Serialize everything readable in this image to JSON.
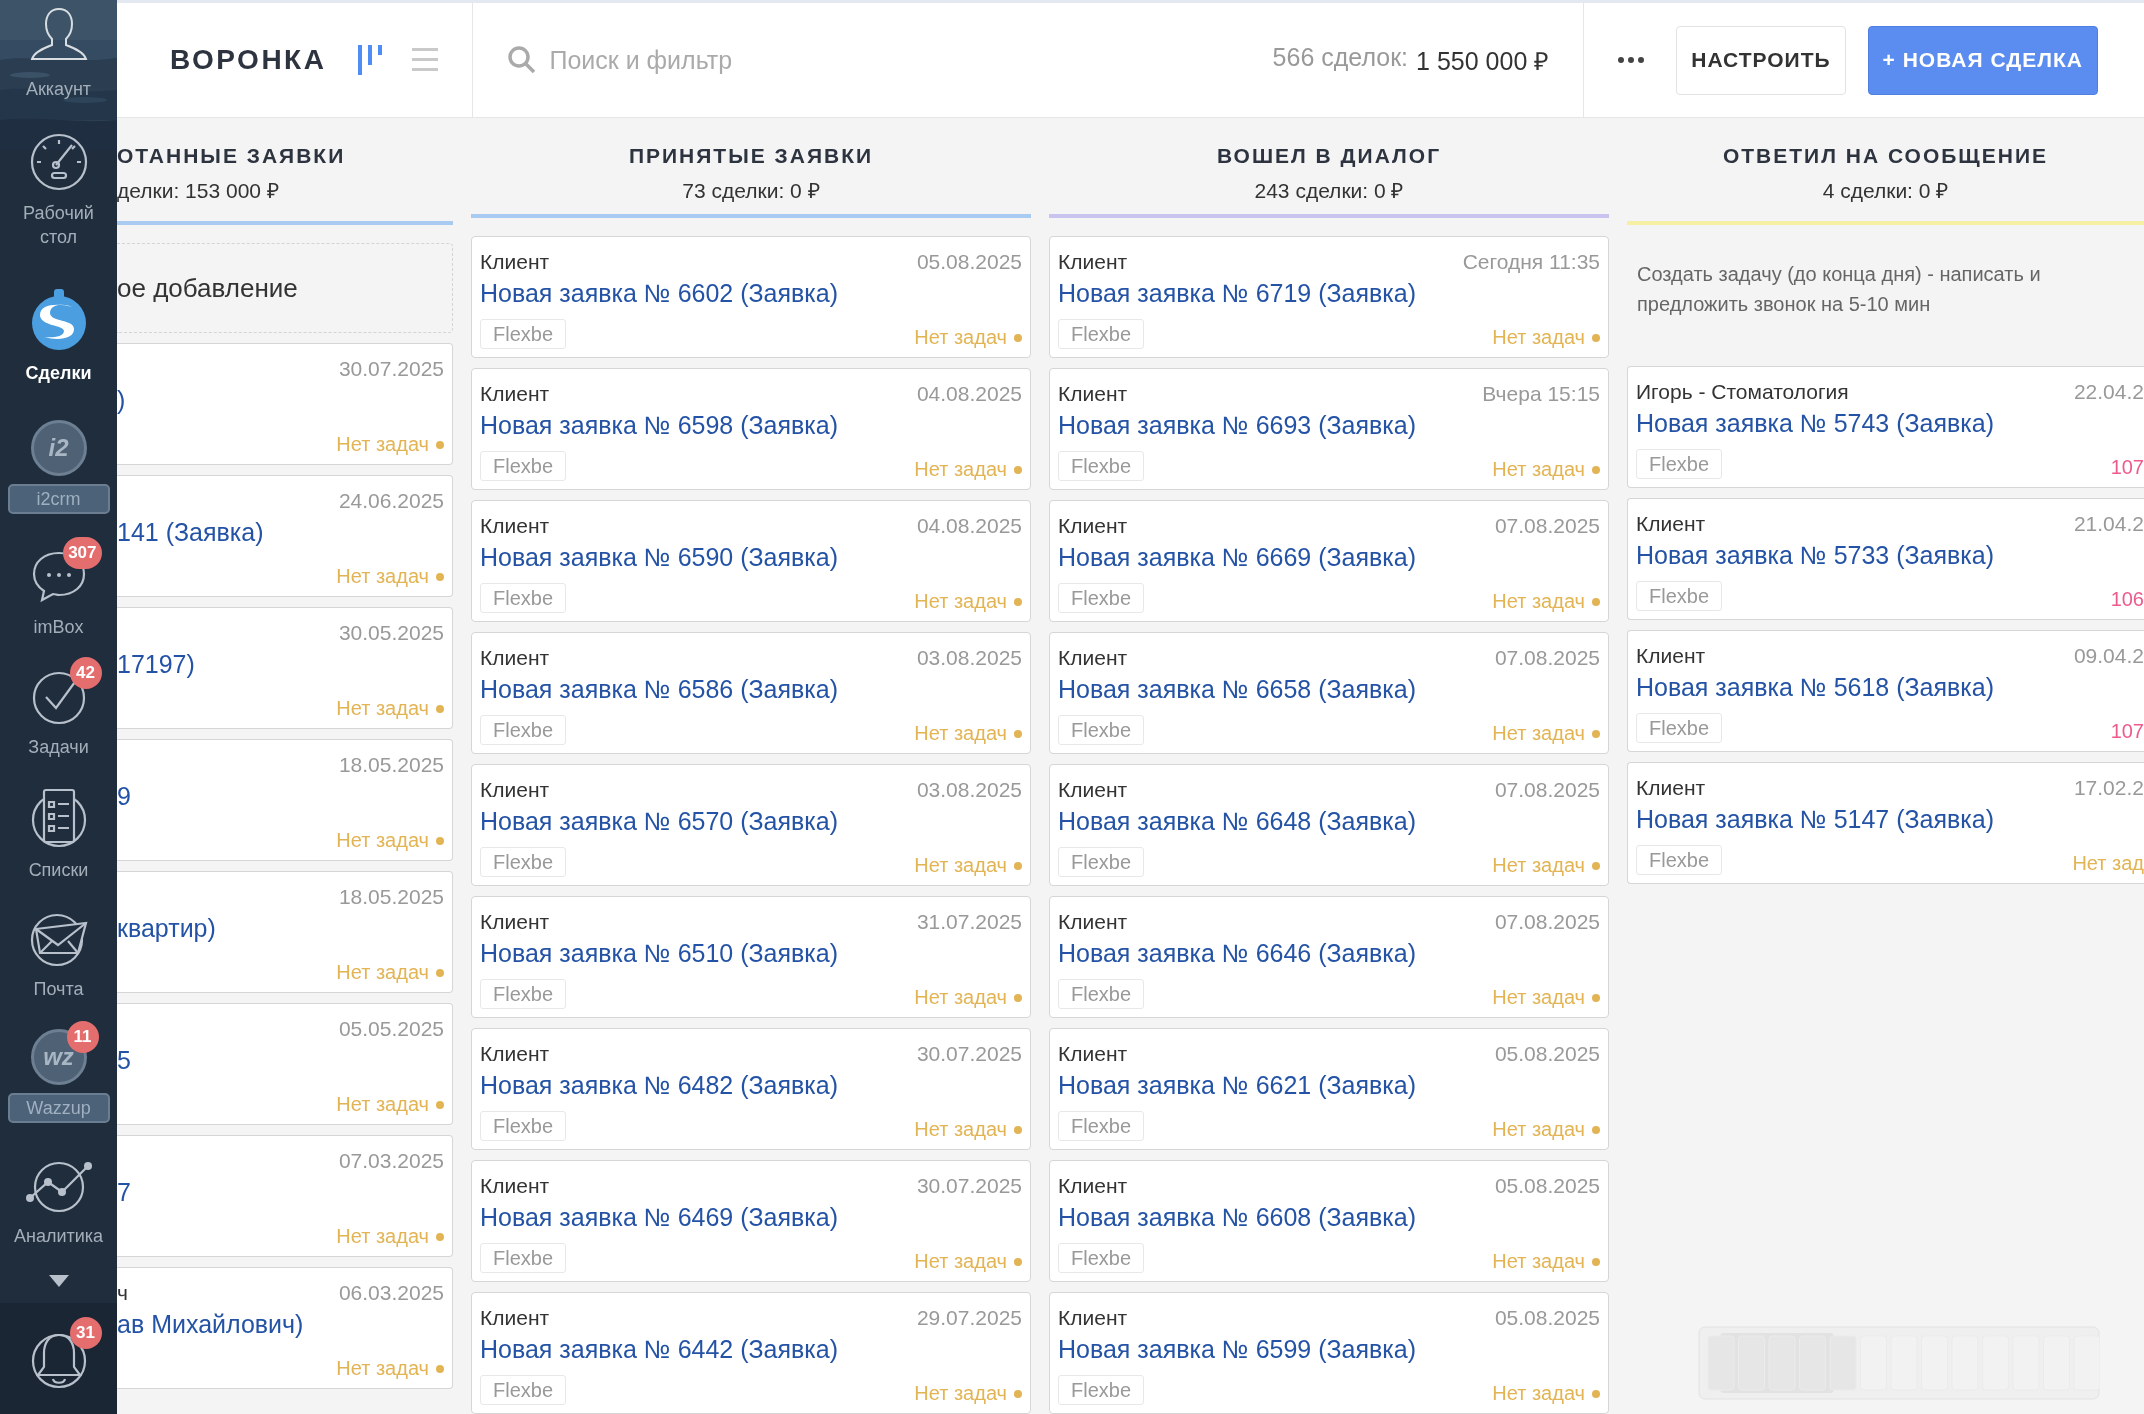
{
  "sidebar": {
    "items": [
      {
        "kind": "account",
        "label": "Аккаунт",
        "selected": false
      },
      {
        "kind": "dashboard",
        "label": "Рабочий стол",
        "selected": false
      },
      {
        "kind": "deals",
        "label": "Сделки",
        "selected": true
      },
      {
        "kind": "app",
        "icon_text": "i2",
        "label": "i2crm",
        "selected": false
      },
      {
        "kind": "chat",
        "label": "imBox",
        "badge": "307",
        "selected": false
      },
      {
        "kind": "tasks",
        "label": "Задачи",
        "badge": "42",
        "selected": false
      },
      {
        "kind": "lists",
        "label": "Списки",
        "selected": false
      },
      {
        "kind": "mail",
        "label": "Почта",
        "selected": false
      },
      {
        "kind": "app",
        "icon_text": "wz",
        "label": "Wazzup",
        "badge": "11",
        "selected": false
      },
      {
        "kind": "analytics",
        "label": "Аналитика",
        "selected": false
      }
    ],
    "notifications": {
      "badge": "31"
    }
  },
  "topbar": {
    "title": "ВОРОНКА",
    "views": [
      {
        "kind": "pipeline",
        "selected": true
      },
      {
        "kind": "list",
        "selected": false
      }
    ],
    "search": {
      "placeholder": "Поиск и фильтр"
    },
    "summary": {
      "count": "566 сделок:",
      "total": "1 550 000 ₽"
    },
    "buttons": [
      {
        "kind": "secondary",
        "label": "НАСТРОИТЬ"
      },
      {
        "kind": "primary",
        "label": "+ НОВАЯ СДЕЛКА"
      }
    ]
  },
  "columns": [
    {
      "title": "ОТАННЫЕ ЗАЯВКИ",
      "summary": "делки: 153 000 ₽",
      "color": "#a9cbf2",
      "quick_add": "ое добавление",
      "cards": [
        {
          "date": "30.07.2025",
          "title": ")",
          "status": {
            "kind": "no_tasks",
            "text": "Нет задач",
            "dot": true
          }
        },
        {
          "date": "24.06.2025",
          "title": "141 (Заявка)",
          "status": {
            "kind": "no_tasks",
            "text": "Нет задач",
            "dot": true
          }
        },
        {
          "date": "30.05.2025",
          "title": "17197)",
          "status": {
            "kind": "no_tasks",
            "text": "Нет задач",
            "dot": true
          }
        },
        {
          "date": "18.05.2025",
          "title": "9",
          "status": {
            "kind": "no_tasks",
            "text": "Нет задач",
            "dot": true
          }
        },
        {
          "date": "18.05.2025",
          "title": "квартир)",
          "status": {
            "kind": "no_tasks",
            "text": "Нет задач",
            "dot": true
          }
        },
        {
          "date": "05.05.2025",
          "title": "5",
          "status": {
            "kind": "no_tasks",
            "text": "Нет задач",
            "dot": true
          }
        },
        {
          "date": "07.03.2025",
          "title": "7",
          "status": {
            "kind": "no_tasks",
            "text": "Нет задач",
            "dot": true
          }
        },
        {
          "client": "ч",
          "date": "06.03.2025",
          "title": "ав Михайлович)",
          "status": {
            "kind": "no_tasks",
            "text": "Нет задач",
            "dot": true
          }
        }
      ]
    },
    {
      "title": "ПРИНЯТЫЕ ЗАЯВКИ",
      "summary": "73 сделки: 0 ₽",
      "color": "#a9cbf2",
      "cards": [
        {
          "client": "Клиент",
          "date": "05.08.2025",
          "title": "Новая заявка № 6602 (Заявка)",
          "tag": "Flexbe",
          "status": {
            "kind": "no_tasks",
            "text": "Нет задач",
            "dot": true
          }
        },
        {
          "client": "Клиент",
          "date": "04.08.2025",
          "title": "Новая заявка № 6598 (Заявка)",
          "tag": "Flexbe",
          "status": {
            "kind": "no_tasks",
            "text": "Нет задач",
            "dot": true
          }
        },
        {
          "client": "Клиент",
          "date": "04.08.2025",
          "title": "Новая заявка № 6590 (Заявка)",
          "tag": "Flexbe",
          "status": {
            "kind": "no_tasks",
            "text": "Нет задач",
            "dot": true
          }
        },
        {
          "client": "Клиент",
          "date": "03.08.2025",
          "title": "Новая заявка № 6586 (Заявка)",
          "tag": "Flexbe",
          "status": {
            "kind": "no_tasks",
            "text": "Нет задач",
            "dot": true
          }
        },
        {
          "client": "Клиент",
          "date": "03.08.2025",
          "title": "Новая заявка № 6570 (Заявка)",
          "tag": "Flexbe",
          "status": {
            "kind": "no_tasks",
            "text": "Нет задач",
            "dot": true
          }
        },
        {
          "client": "Клиент",
          "date": "31.07.2025",
          "title": "Новая заявка № 6510 (Заявка)",
          "tag": "Flexbe",
          "status": {
            "kind": "no_tasks",
            "text": "Нет задач",
            "dot": true
          }
        },
        {
          "client": "Клиент",
          "date": "30.07.2025",
          "title": "Новая заявка № 6482 (Заявка)",
          "tag": "Flexbe",
          "status": {
            "kind": "no_tasks",
            "text": "Нет задач",
            "dot": true
          }
        },
        {
          "client": "Клиент",
          "date": "30.07.2025",
          "title": "Новая заявка № 6469 (Заявка)",
          "tag": "Flexbe",
          "status": {
            "kind": "no_tasks",
            "text": "Нет задач",
            "dot": true
          }
        },
        {
          "client": "Клиент",
          "date": "29.07.2025",
          "title": "Новая заявка № 6442 (Заявка)",
          "tag": "Flexbe",
          "status": {
            "kind": "no_tasks",
            "text": "Нет задач",
            "dot": true
          }
        }
      ]
    },
    {
      "title": "ВОШЕЛ В ДИАЛОГ",
      "summary": "243 сделки: 0 ₽",
      "color": "#c9c3f0",
      "cards": [
        {
          "client": "Клиент",
          "date": "Сегодня 11:35",
          "title": "Новая заявка № 6719 (Заявка)",
          "tag": "Flexbe",
          "status": {
            "kind": "no_tasks",
            "text": "Нет задач",
            "dot": true
          }
        },
        {
          "client": "Клиент",
          "date": "Вчера 15:15",
          "title": "Новая заявка № 6693 (Заявка)",
          "tag": "Flexbe",
          "status": {
            "kind": "no_tasks",
            "text": "Нет задач",
            "dot": true
          }
        },
        {
          "client": "Клиент",
          "date": "07.08.2025",
          "title": "Новая заявка № 6669 (Заявка)",
          "tag": "Flexbe",
          "status": {
            "kind": "no_tasks",
            "text": "Нет задач",
            "dot": true
          }
        },
        {
          "client": "Клиент",
          "date": "07.08.2025",
          "title": "Новая заявка № 6658 (Заявка)",
          "tag": "Flexbe",
          "status": {
            "kind": "no_tasks",
            "text": "Нет задач",
            "dot": true
          }
        },
        {
          "client": "Клиент",
          "date": "07.08.2025",
          "title": "Новая заявка № 6648 (Заявка)",
          "tag": "Flexbe",
          "status": {
            "kind": "no_tasks",
            "text": "Нет задач",
            "dot": true
          }
        },
        {
          "client": "Клиент",
          "date": "07.08.2025",
          "title": "Новая заявка № 6646 (Заявка)",
          "tag": "Flexbe",
          "status": {
            "kind": "no_tasks",
            "text": "Нет задач",
            "dot": true
          }
        },
        {
          "client": "Клиент",
          "date": "05.08.2025",
          "title": "Новая заявка № 6621 (Заявка)",
          "tag": "Flexbe",
          "status": {
            "kind": "no_tasks",
            "text": "Нет задач",
            "dot": true
          }
        },
        {
          "client": "Клиент",
          "date": "05.08.2025",
          "title": "Новая заявка № 6608 (Заявка)",
          "tag": "Flexbe",
          "status": {
            "kind": "no_tasks",
            "text": "Нет задач",
            "dot": true
          }
        },
        {
          "client": "Клиент",
          "date": "05.08.2025",
          "title": "Новая заявка № 6599 (Заявка)",
          "tag": "Flexbe",
          "status": {
            "kind": "no_tasks",
            "text": "Нет задач",
            "dot": true
          }
        }
      ]
    },
    {
      "title": "ОТВЕТИЛ НА СООБЩЕНИЕ",
      "summary": "4 сделки: 0 ₽",
      "color": "#f5f0a3",
      "note": "Создать задачу (до конца дня) - написать и предложить звонок на 5-10 мин",
      "cards": [
        {
          "client": "Игорь - Стоматология",
          "date": "22.04.2",
          "title": "Новая заявка № 5743 (Заявка)",
          "tag": "Flexbe",
          "status": {
            "kind": "overdue",
            "text": "107",
            "dot": false
          }
        },
        {
          "client": "Клиент",
          "date": "21.04.2",
          "title": "Новая заявка № 5733 (Заявка)",
          "tag": "Flexbe",
          "status": {
            "kind": "overdue",
            "text": "106",
            "dot": false
          }
        },
        {
          "client": "Клиент",
          "date": "09.04.2",
          "title": "Новая заявка № 5618 (Заявка)",
          "tag": "Flexbe",
          "status": {
            "kind": "overdue",
            "text": "107",
            "dot": false
          }
        },
        {
          "client": "Клиент",
          "date": "17.02.2",
          "title": "Новая заявка № 5147 (Заявка)",
          "tag": "Flexbe",
          "status": {
            "kind": "no_tasks",
            "text": "Нет зад",
            "dot": false
          }
        }
      ]
    }
  ]
}
